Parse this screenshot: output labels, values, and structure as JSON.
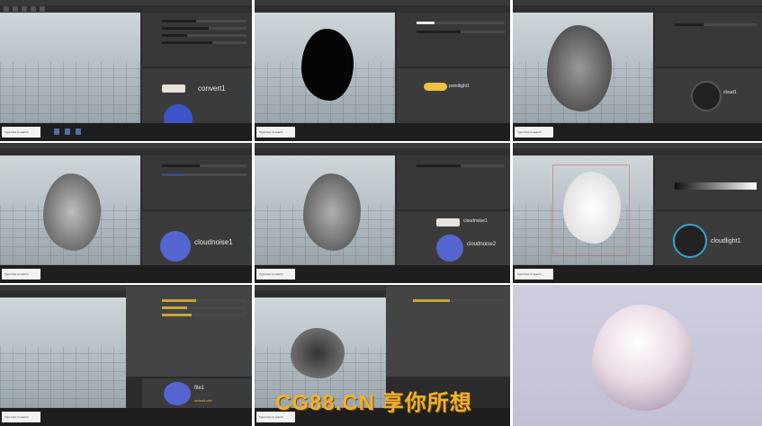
{
  "panels": [
    {
      "id": 1,
      "node_label": "convert1",
      "node_sub": ""
    },
    {
      "id": 2,
      "node_label": "pointlight1",
      "node_sub": ""
    },
    {
      "id": 3,
      "node_label": "cloud1",
      "node_sub": ""
    },
    {
      "id": 4,
      "node_label": "cloudnoise1",
      "node_sub": ""
    },
    {
      "id": 5,
      "node_label": "cloudnoise2",
      "node_label_upper": "cloudnoise1"
    },
    {
      "id": 6,
      "node_label": "cloudlight1",
      "node_sub": ""
    },
    {
      "id": 7,
      "node_label": "file1",
      "node_sub": "default.vdb"
    },
    {
      "id": 8,
      "node_label": "",
      "node_sub": ""
    },
    {
      "id": 9,
      "node_label": "",
      "node_sub": ""
    }
  ],
  "taskbar": {
    "search_placeholder": "Type here to search"
  },
  "watermark": "CG88.CN 享你所想",
  "colors": {
    "houdini_bg": "#2b2b2b",
    "viewport_sky": "#c4ccd1",
    "final_bg": "#c9c7d8",
    "watermark": "#f0b030"
  }
}
